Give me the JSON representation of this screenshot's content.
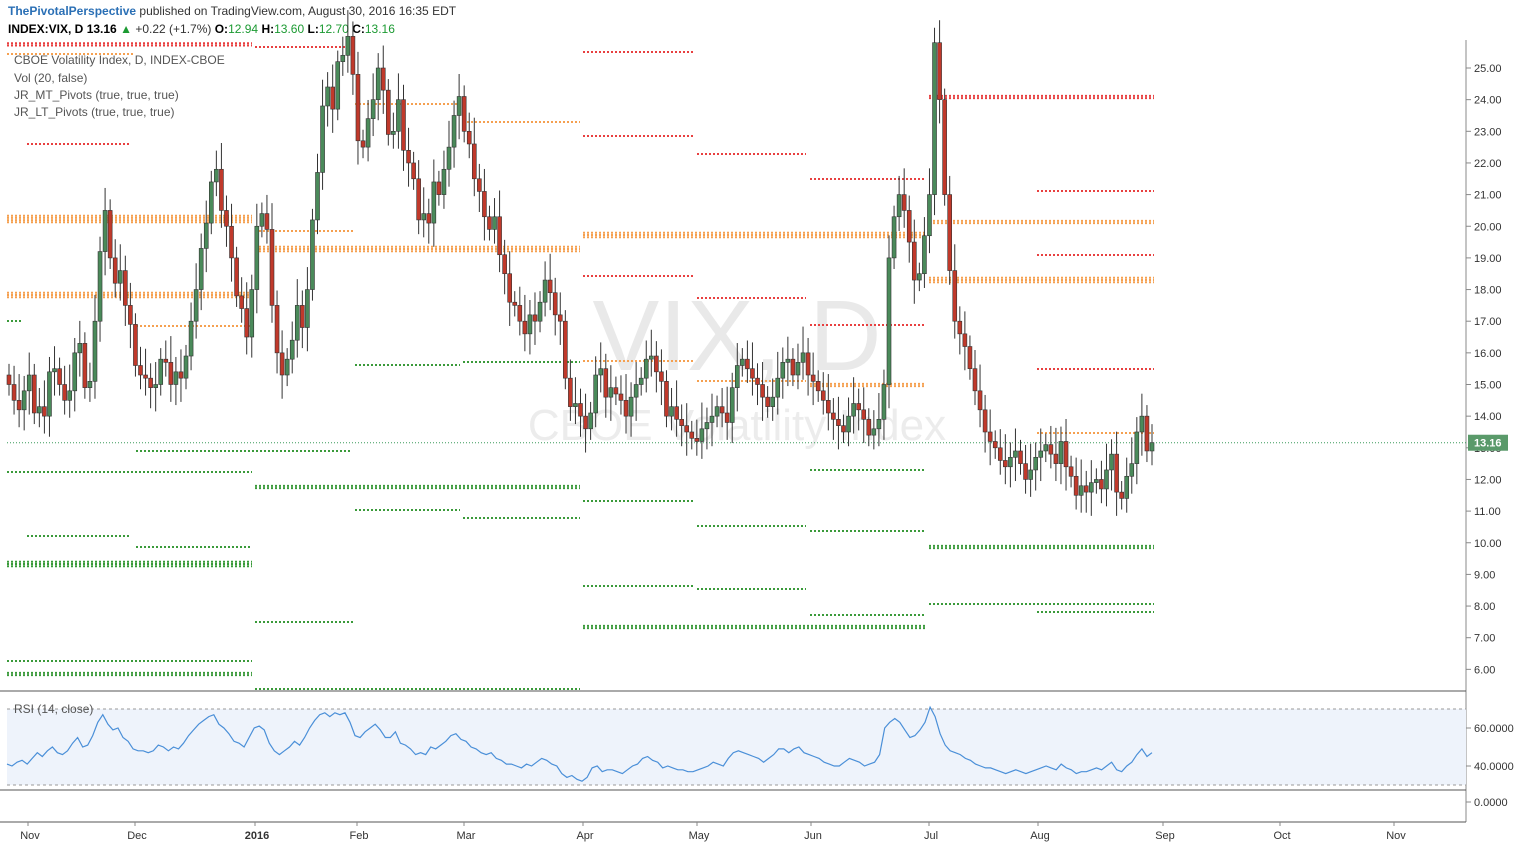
{
  "header": {
    "author": "ThePivotalPerspective",
    "published": "published on TradingView.com, August 30, 2016 16:35 EDT",
    "symbol": "INDEX:VIX, D",
    "last": "13.16",
    "change": "+0.22 (+1.7%)",
    "o_label": "O:",
    "o_val": "12.94",
    "h_label": "H:",
    "h_val": "13.60",
    "l_label": "L:",
    "l_val": "12.70",
    "c_label": "C:",
    "c_val": "13.16"
  },
  "legend": [
    "CBOE Volatility Index, D, INDEX-CBOE",
    "Vol (20, false)",
    "JR_MT_Pivots (true, true, true)",
    "JR_LT_Pivots (true, true, true)"
  ],
  "rsi_legend": "RSI (14, close)",
  "watermark": {
    "symbol": "VIX, D",
    "name": "CBOE Volatility Index"
  },
  "colors": {
    "up": "#4a8a5a",
    "down": "#c0392b",
    "pivot_red": "#e84040",
    "pivot_orange": "#f5a050",
    "pivot_green": "#3a9a3a",
    "rsi": "#4a8fd8",
    "rsi_band": "#eef3fb",
    "last_badge": "#5a9a6a"
  },
  "chart_data": [
    {
      "type": "candlestick",
      "title": "CBOE Volatility Index, D, INDEX-CBOE",
      "ylim": [
        5,
        26
      ],
      "yticks": [
        "25.00",
        "24.00",
        "23.00",
        "22.00",
        "21.00",
        "20.00",
        "19.00",
        "18.00",
        "17.00",
        "16.00",
        "15.00",
        "14.00",
        "13.00",
        "12.00",
        "11.00",
        "10.00",
        "9.00",
        "8.00",
        "7.00",
        "6.00"
      ],
      "xticks": [
        "Nov",
        "Dec",
        "2016",
        "Feb",
        "Mar",
        "Apr",
        "May",
        "Jun",
        "Jul",
        "Aug",
        "Sep",
        "Oct",
        "Nov"
      ],
      "last_value": "13.16",
      "closes": [
        15.0,
        14.5,
        14.2,
        14.8,
        15.3,
        14.1,
        14.3,
        14.0,
        15.4,
        15.5,
        15.0,
        14.5,
        14.8,
        16.0,
        16.3,
        14.9,
        15.1,
        17.0,
        19.2,
        20.5,
        19.0,
        18.2,
        18.6,
        17.5,
        16.9,
        15.6,
        15.3,
        15.2,
        14.9,
        15.0,
        15.8,
        15.7,
        15.0,
        15.4,
        15.2,
        15.9,
        17.0,
        18.0,
        19.3,
        20.1,
        21.4,
        21.8,
        20.5,
        20.0,
        19.0,
        17.8,
        17.4,
        16.5,
        18.0,
        20.0,
        20.4,
        19.9,
        17.5,
        16.0,
        15.3,
        15.8,
        16.4,
        17.5,
        16.8,
        18.0,
        20.2,
        21.7,
        23.8,
        24.4,
        23.7,
        25.2,
        25.4,
        26.0,
        24.8,
        22.7,
        22.5,
        23.4,
        24.0,
        25.0,
        24.3,
        22.9,
        23.0,
        24.0,
        22.4,
        22.0,
        21.5,
        20.2,
        20.4,
        20.1,
        21.4,
        21.0,
        21.8,
        22.5,
        23.5,
        24.1,
        23.0,
        22.6,
        21.5,
        21.1,
        20.3,
        19.9,
        20.3,
        19.1,
        18.5,
        17.6,
        17.5,
        17.0,
        16.6,
        17.2,
        17.0,
        17.6,
        18.3,
        17.9,
        17.2,
        17.0,
        15.2,
        14.3,
        14.4,
        14.0,
        13.6,
        14.1,
        15.3,
        15.5,
        14.6,
        14.9,
        14.7,
        14.5,
        14.0,
        14.6,
        15.0,
        15.2,
        15.8,
        15.9,
        15.4,
        15.1,
        14.0,
        14.3,
        13.9,
        13.7,
        13.5,
        13.3,
        13.2,
        13.6,
        13.8,
        14.0,
        14.3,
        14.1,
        13.8,
        14.9,
        15.6,
        15.8,
        15.5,
        15.2,
        15.0,
        14.6,
        14.3,
        14.6,
        15.2,
        15.7,
        15.8,
        15.3,
        15.7,
        16.0,
        15.3,
        15.1,
        14.8,
        14.5,
        14.1,
        13.9,
        13.7,
        13.5,
        14.0,
        14.4,
        14.2,
        13.9,
        13.4,
        13.6,
        13.9,
        15.0,
        19.0,
        20.3,
        21.0,
        20.5,
        19.5,
        18.3,
        18.5,
        19.7,
        21.0,
        25.8,
        24.0,
        21.0,
        18.6,
        17.0,
        16.6,
        16.2,
        15.5,
        14.8,
        14.2,
        13.5,
        13.2,
        13.0,
        12.6,
        12.4,
        12.7,
        12.9,
        12.5,
        12.0,
        12.3,
        12.7,
        12.9,
        13.1,
        12.8,
        12.5,
        13.2,
        12.4,
        12.1,
        11.5,
        11.8,
        11.6,
        11.9,
        12.0,
        11.7,
        12.3,
        12.8,
        11.6,
        11.4,
        12.1,
        12.5,
        13.5,
        14.0,
        12.9,
        13.16
      ]
    },
    {
      "type": "line",
      "title": "RSI (14, close)",
      "ylim": [
        0,
        80
      ],
      "yticks": [
        "60.0000",
        "40.0000",
        "0.0000"
      ],
      "band": [
        30,
        70
      ],
      "values": [
        41,
        40,
        42,
        43,
        41,
        44,
        47,
        45,
        48,
        50,
        47,
        46,
        48,
        52,
        55,
        50,
        51,
        56,
        63,
        67,
        62,
        59,
        60,
        55,
        53,
        49,
        48,
        48,
        47,
        48,
        51,
        50,
        48,
        50,
        49,
        52,
        56,
        59,
        62,
        64,
        66,
        67,
        62,
        60,
        57,
        53,
        52,
        50,
        55,
        60,
        61,
        59,
        52,
        48,
        46,
        48,
        50,
        53,
        51,
        55,
        60,
        64,
        67,
        68,
        66,
        68,
        67,
        68,
        63,
        56,
        55,
        58,
        60,
        62,
        59,
        55,
        55,
        58,
        52,
        51,
        49,
        46,
        47,
        46,
        50,
        49,
        51,
        53,
        56,
        57,
        54,
        53,
        50,
        49,
        47,
        46,
        47,
        44,
        43,
        41,
        41,
        40,
        39,
        41,
        40,
        42,
        44,
        43,
        41,
        40,
        36,
        34,
        35,
        33,
        32,
        34,
        39,
        40,
        37,
        38,
        38,
        37,
        36,
        38,
        40,
        41,
        44,
        45,
        43,
        42,
        39,
        40,
        39,
        38,
        38,
        37,
        37,
        38,
        39,
        40,
        42,
        41,
        40,
        44,
        47,
        48,
        47,
        46,
        45,
        44,
        42,
        44,
        46,
        49,
        49,
        47,
        49,
        50,
        47,
        46,
        45,
        44,
        42,
        41,
        40,
        40,
        42,
        44,
        43,
        42,
        40,
        41,
        42,
        46,
        60,
        63,
        65,
        63,
        59,
        55,
        56,
        59,
        63,
        71,
        66,
        57,
        51,
        48,
        47,
        46,
        44,
        43,
        41,
        40,
        39,
        39,
        38,
        37,
        36,
        37,
        38,
        37,
        36,
        37,
        38,
        39,
        40,
        39,
        38,
        41,
        39,
        38,
        36,
        37,
        37,
        38,
        39,
        38,
        40,
        42,
        38,
        37,
        40,
        42,
        46,
        49,
        45,
        47
      ]
    }
  ]
}
